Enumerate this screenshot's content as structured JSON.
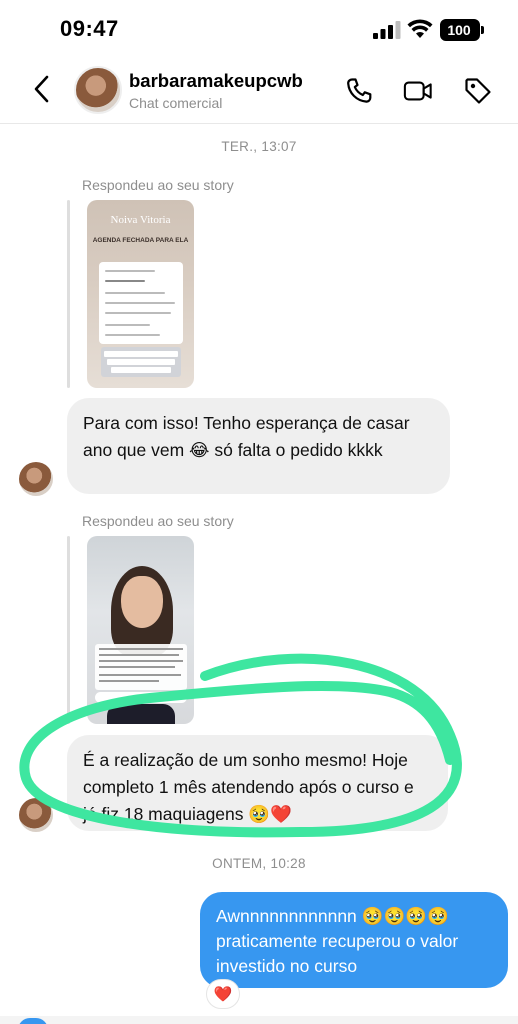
{
  "status_bar": {
    "time": "09:47",
    "battery": "100"
  },
  "header": {
    "title": "barbaramakeupcwb",
    "subtitle": "Chat comercial"
  },
  "chat": {
    "timestamp_1": "TER., 13:07",
    "story_reply_1": {
      "label": "Respondeu ao seu story",
      "thumb_title": "Noiva Vitoria",
      "thumb_caption": "AGENDA FECHADA PARA ELA"
    },
    "message_1": "Para com isso! Tenho esperança de casar ano que vem 😂 só falta o pedido kkkk",
    "story_reply_2": {
      "label": "Respondeu ao seu story"
    },
    "message_2": "É a realização de um sonho mesmo! Hoje completo 1 mês atendendo após o curso e já fiz 18 maquiagens 🥹❤️",
    "timestamp_2": "ONTEM, 10:28",
    "message_3": "Awnnnnnnnnnnnn 🥹🥹🥹🥹 praticamente recuperou o valor investido no curso",
    "reaction": "❤️"
  },
  "colors": {
    "outgoing_bubble": "#3797f0",
    "incoming_bubble": "#efefef",
    "highlight": "#3ee6a0"
  },
  "icons": [
    "back-icon",
    "phone-icon",
    "video-icon",
    "tag-icon",
    "signal-icon",
    "wifi-icon",
    "battery-icon"
  ]
}
